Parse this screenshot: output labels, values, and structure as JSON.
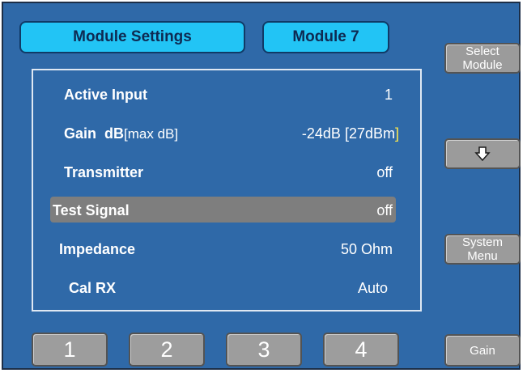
{
  "header": {
    "title": "Module Settings",
    "module": "Module 7"
  },
  "settings": [
    {
      "label": "Active Input",
      "value": "1"
    },
    {
      "label_bold": "Gain  dB",
      "label_sub": "[max dB]",
      "value_main": "-24dB [27dBm",
      "value_bracket": "]"
    },
    {
      "label": "Transmitter",
      "value": "off"
    },
    {
      "label": "Test Signal",
      "value": "off",
      "selected": true
    },
    {
      "label": "Impedance",
      "value": "50 Ohm"
    },
    {
      "label": "Cal RX",
      "value": "Auto"
    }
  ],
  "side_buttons": {
    "select_module_line1": "Select",
    "select_module_line2": "Module",
    "down": "down-arrow-icon",
    "system_menu_line1": "System",
    "system_menu_line2": "Menu",
    "gain": "Gain"
  },
  "number_buttons": [
    "1",
    "2",
    "3",
    "4"
  ],
  "colors": {
    "background": "#2f69a8",
    "header_button": "#22c4f5",
    "highlight": "#7e7e7e",
    "selected_text": "#ffe94a",
    "button_gray": "#9b9b9b"
  }
}
